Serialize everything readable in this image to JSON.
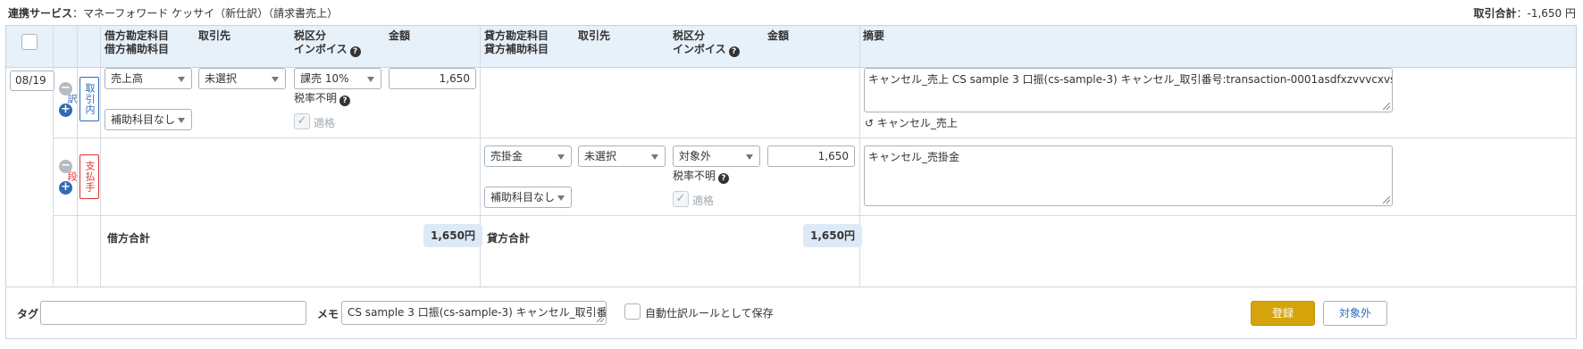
{
  "top": {
    "service_label": "連携サービス",
    "service_value": "：マネーフォワード ケッサイ（新仕訳）（請求書売上）",
    "total_label": "取引合計",
    "total_value": "：-1,650 円"
  },
  "header": {
    "debit_account": "借方勘定科目",
    "debit_sub_account": "借方補助科目",
    "debit_partner": "取引先",
    "debit_tax": "税区分",
    "debit_invoice": "インボイス",
    "debit_amount": "金額",
    "credit_account": "貸方勘定科目",
    "credit_sub_account": "貸方補助科目",
    "credit_partner": "取引先",
    "credit_tax": "税区分",
    "credit_invoice": "インボイス",
    "credit_amount": "金額",
    "memo": "摘要"
  },
  "row1": {
    "date": "08/19",
    "tag": "取引内訳",
    "debit_account": "売上高",
    "debit_partner": "未選択",
    "debit_sub": "補助科目なし",
    "debit_tax": "課売 10%",
    "tax_rate_note": "税率不明",
    "qualified": "適格",
    "amount": "1,650",
    "memo": "キャンセル_売上 CS sample 3 口振(cs-sample-3) キャンセル_取引番号:transaction-0001asdfxzvvvcxvs",
    "restore_label": "キャンセル_売上"
  },
  "row2": {
    "tag": "支払手段",
    "credit_account": "売掛金",
    "credit_partner": "未選択",
    "credit_sub": "補助科目なし",
    "credit_tax": "対象外",
    "tax_rate_note": "税率不明",
    "qualified": "適格",
    "amount": "1,650",
    "memo": "キャンセル_売掛金"
  },
  "totals": {
    "debit_label": "借方合計",
    "debit_value": "1,650円",
    "credit_label": "貸方合計",
    "credit_value": "1,650円"
  },
  "bottom": {
    "tag_label": "タグ",
    "tag_value": "",
    "memo_label": "メモ",
    "memo_value": "CS sample 3 口振(cs-sample-3) キャンセル_取引番",
    "auto_rule_label": "自動仕訳ルールとして保存",
    "register_label": "登録",
    "exclude_label": "対象外"
  },
  "colors": {
    "header_bg": "#e7f1fa",
    "primary_button": "#d4a40a",
    "link_blue": "#2f6bb6",
    "total_pill": "#dde9f6"
  },
  "icons": [
    "minus-circle-icon",
    "plus-circle-icon",
    "question-icon",
    "caret-down-icon",
    "check-icon",
    "undo-icon",
    "resize-handle-icon"
  ]
}
